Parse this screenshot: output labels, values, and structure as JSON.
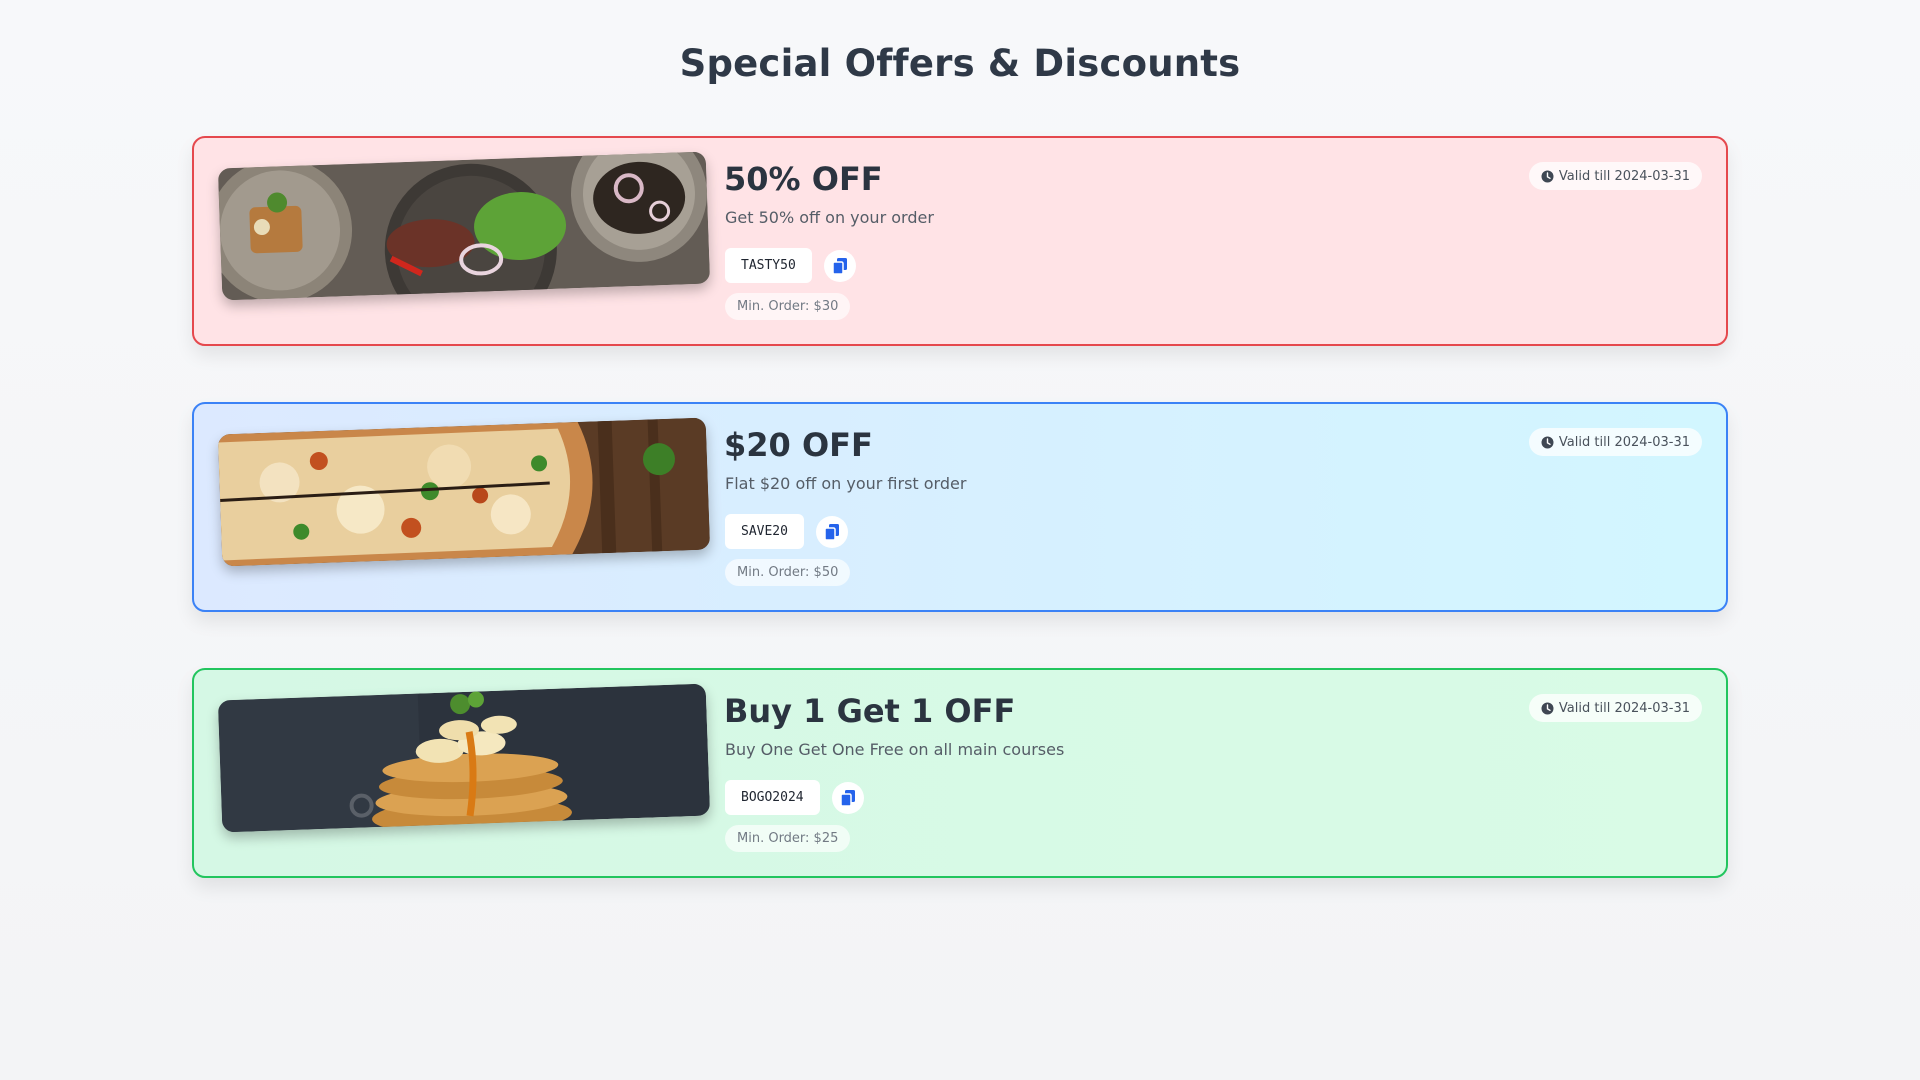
{
  "page": {
    "title": "Special Offers & Discounts"
  },
  "offers": [
    {
      "title": "50% OFF",
      "description": "Get 50% off on your order",
      "code": "TASTY50",
      "min_order": "Min. Order: $30",
      "valid": "Valid till 2024-03-31",
      "image": "grilled-meat-salad-platter",
      "accent": "#e5484d"
    },
    {
      "title": "$20 OFF",
      "description": "Flat $20 off on your first order",
      "code": "SAVE20",
      "min_order": "Min. Order: $50",
      "valid": "Valid till 2024-03-31",
      "image": "chicken-pizza",
      "accent": "#3b82f6"
    },
    {
      "title": "Buy 1 Get 1 OFF",
      "description": "Buy One Get One Free on all main courses",
      "code": "BOGO2024",
      "min_order": "Min. Order: $25",
      "valid": "Valid till 2024-03-31",
      "image": "banana-pancake-stack",
      "accent": "#22c55e"
    }
  ],
  "icons": {
    "copy": "copy-icon",
    "clock": "clock-icon"
  }
}
